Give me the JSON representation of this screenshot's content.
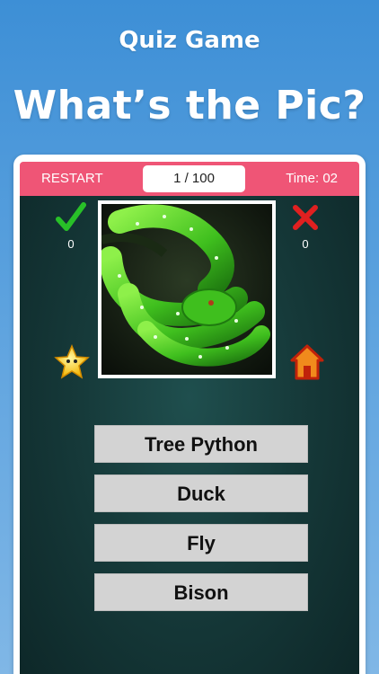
{
  "header": {
    "app_title": "Quiz Game",
    "headline": "What’s the Pic?"
  },
  "topbar": {
    "restart_label": "RESTART",
    "progress": "1 / 100",
    "timer": "Time: 02",
    "bar_color": "#ef5576"
  },
  "score": {
    "correct_icon": "checkmark-icon",
    "correct_count": "0",
    "wrong_icon": "x-mark-icon",
    "wrong_count": "0"
  },
  "side_buttons": {
    "left_icon": "star-icon",
    "right_icon": "home-icon"
  },
  "question_image": {
    "subject": "green tree python coiled on a branch"
  },
  "answers": [
    {
      "label": "Tree Python"
    },
    {
      "label": "Duck"
    },
    {
      "label": "Fly"
    },
    {
      "label": "Bison"
    }
  ],
  "colors": {
    "background": "#4f9bdd",
    "board": "#163a3a",
    "answer_button": "#d3d3d3",
    "correct": "#28c028",
    "wrong": "#e02020"
  }
}
